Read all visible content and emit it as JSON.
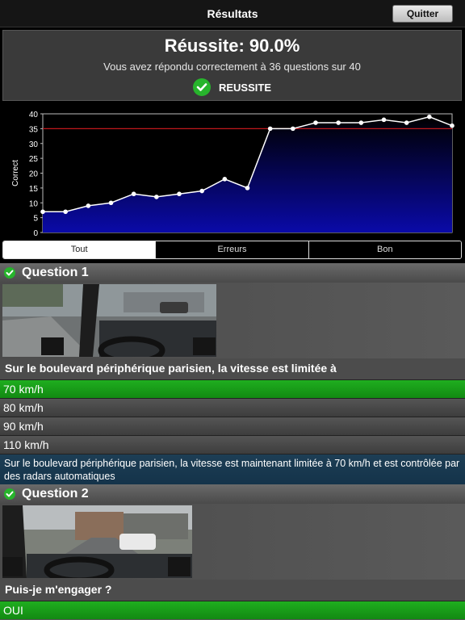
{
  "header": {
    "title": "Résultats",
    "quit_label": "Quitter"
  },
  "summary": {
    "score": "Réussite: 90.0%",
    "detail": "Vous avez répondu correctement à 36 questions sur 40",
    "status": "REUSSITE"
  },
  "chart_data": {
    "type": "line",
    "title": "",
    "xlabel": "",
    "ylabel": "Correct",
    "ylim": [
      0,
      40
    ],
    "yticks": [
      0,
      5,
      10,
      15,
      20,
      25,
      30,
      35,
      40
    ],
    "threshold": 35,
    "series": [
      {
        "values": [
          7,
          7,
          9,
          10,
          13,
          12,
          13,
          14,
          18,
          15,
          35,
          35,
          37,
          37,
          37,
          38,
          37,
          39,
          36
        ]
      }
    ],
    "grid": false,
    "colors": {
      "line": "#ffffff",
      "threshold": "#c0181c",
      "fill_top": "#000000",
      "fill_bottom": "#0a0aa8"
    }
  },
  "tabs": [
    {
      "label": "Tout",
      "active": true
    },
    {
      "label": "Erreurs",
      "active": false
    },
    {
      "label": "Bon",
      "active": false
    }
  ],
  "questions": [
    {
      "title": "Question 1",
      "text": "Sur le boulevard périphérique parisien, la vitesse est limitée à",
      "answers": [
        "70 km/h",
        "80 km/h",
        "90 km/h",
        "110 km/h"
      ],
      "correct_index": 0,
      "explanation": "Sur le boulevard périphérique parisien, la vitesse est maintenant limitée à 70 km/h et est contrôlée par des radars automatiques"
    },
    {
      "title": "Question 2",
      "text": "Puis-je m'engager ?",
      "answers": [
        "OUI"
      ],
      "correct_index": 0
    }
  ]
}
